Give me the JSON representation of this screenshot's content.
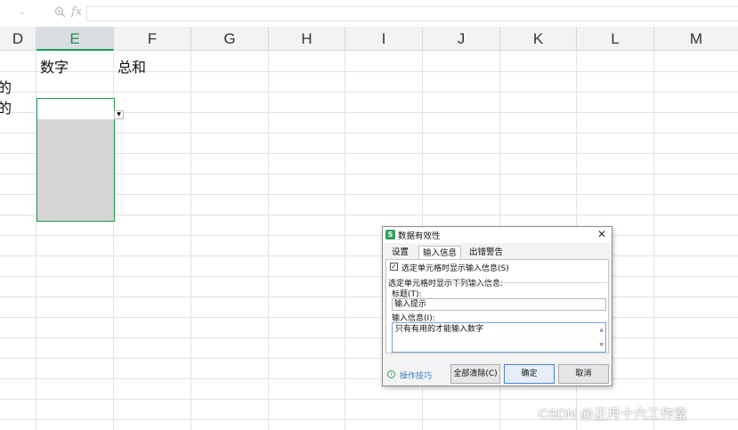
{
  "formula_bar": {
    "namebox_arrow": "⌄",
    "fx_label": "fx"
  },
  "columns": [
    "D",
    "E",
    "F",
    "G",
    "H",
    "I",
    "J",
    "K",
    "L",
    "M"
  ],
  "cells": {
    "e1": "数字",
    "f1": "总和",
    "d2": "的",
    "d3": "的"
  },
  "dialog": {
    "title": "数据有效性",
    "tabs": [
      "设置",
      "输入信息",
      "出错警告"
    ],
    "show_input_checkbox": "选定单元格时显示输入信息(S)",
    "section_label": "选定单元格时显示下列输入信息:",
    "title_label": "标题(T):",
    "title_value": "输入提示",
    "message_label": "输入信息(I):",
    "message_value": "只有有用的才能输入数字",
    "tips_link": "操作技巧",
    "buttons": {
      "clear_all": "全部清除(C)",
      "ok": "确定",
      "cancel": "取消"
    }
  },
  "watermark": "CSDN @正月十六工作室",
  "colors": {
    "accent": "#1f9c55",
    "selection_fill": "#d5d5d5",
    "link": "#3a79c8"
  }
}
